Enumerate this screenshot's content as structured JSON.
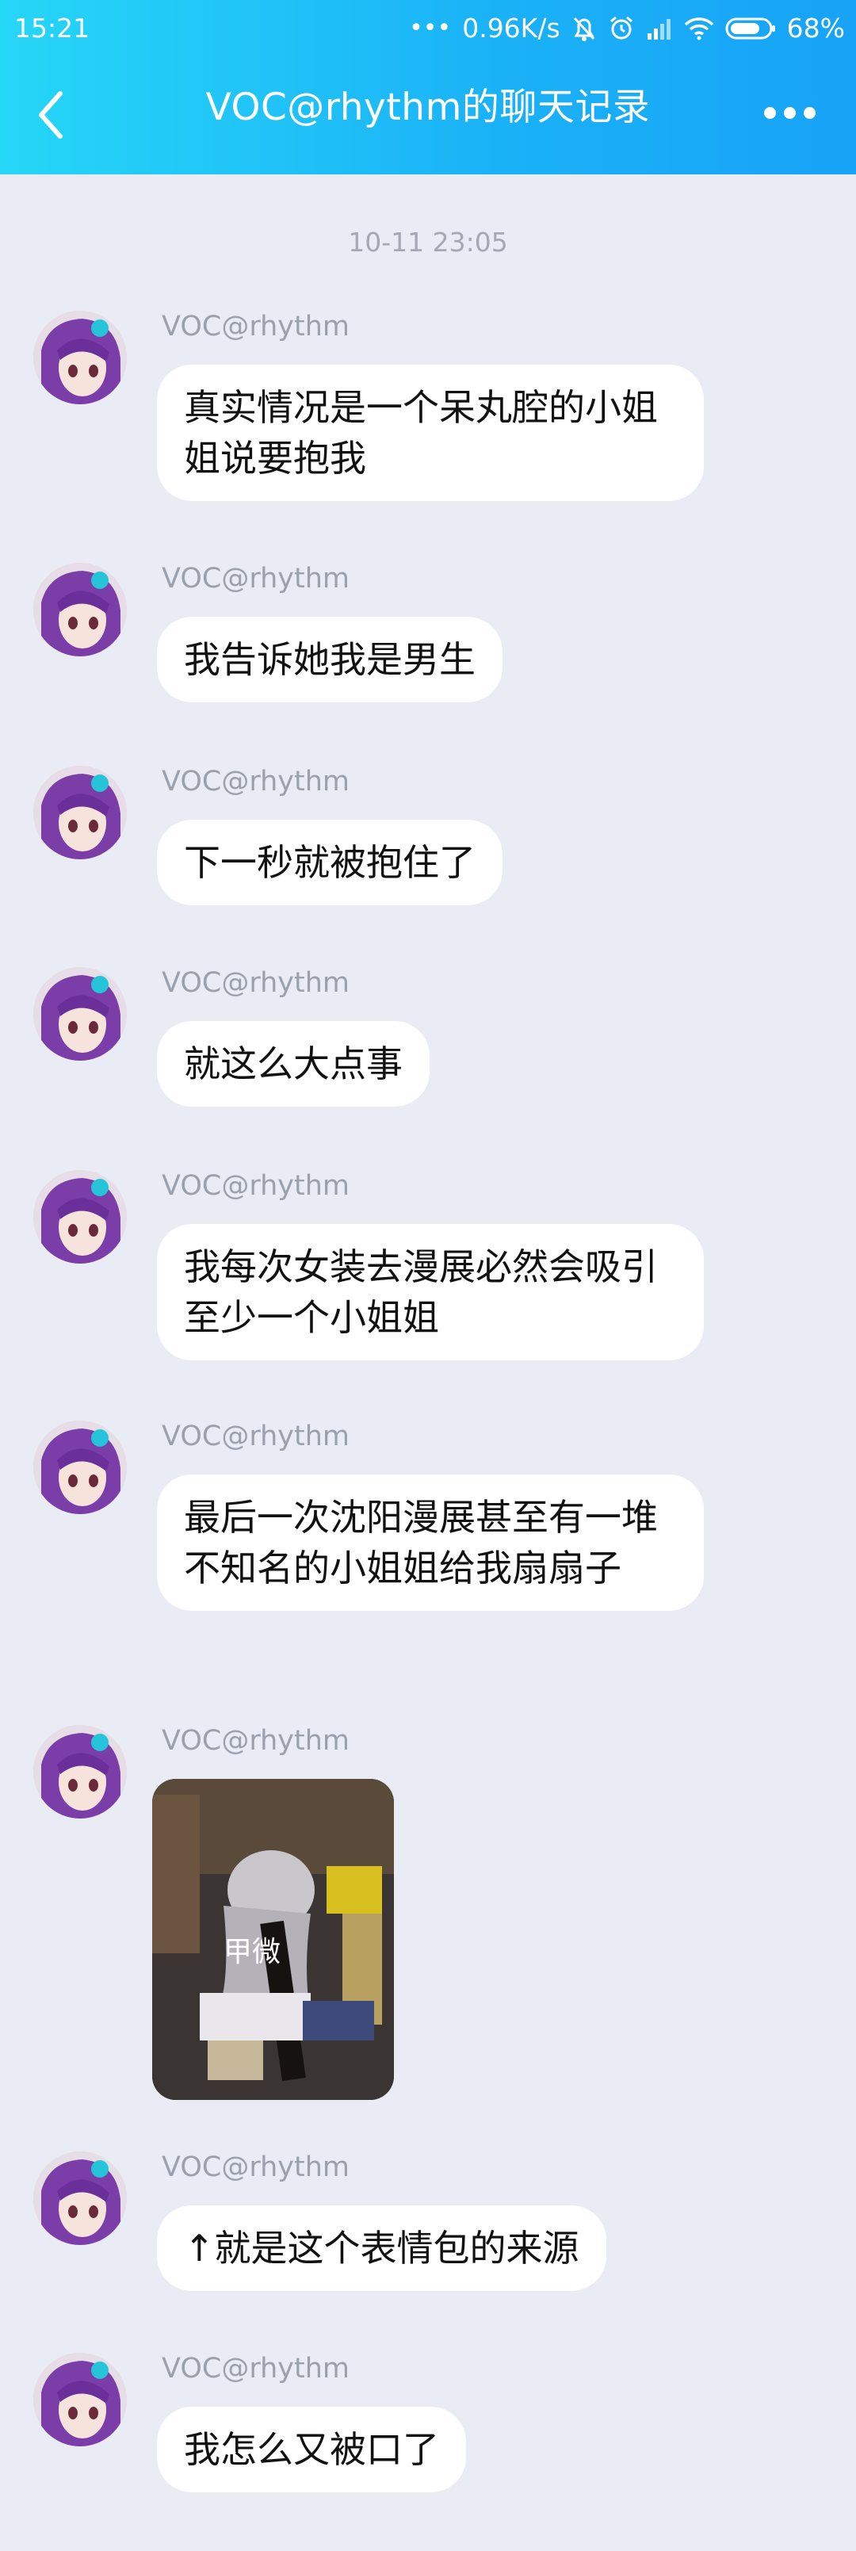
{
  "status": {
    "time": "15:21",
    "speed": "0.96K/s",
    "battery": "68%"
  },
  "header": {
    "title": "VOC@rhythm的聊天记录"
  },
  "timestamp": "10-11 23:05",
  "messages": [
    {
      "sender": "VOC@rhythm",
      "text": "真实情况是一个呆丸腔的小姐姐说要抱我"
    },
    {
      "sender": "VOC@rhythm",
      "text": "我告诉她我是男生"
    },
    {
      "sender": "VOC@rhythm",
      "text": "下一秒就被抱住了"
    },
    {
      "sender": "VOC@rhythm",
      "text": "就这么大点事"
    },
    {
      "sender": "VOC@rhythm",
      "text": "我每次女装去漫展必然会吸引至少一个小姐姐"
    },
    {
      "sender": "VOC@rhythm",
      "text": "最后一次沈阳漫展甚至有一堆不知名的小姐姐给我扇扇子"
    },
    {
      "sender": "VOC@rhythm",
      "image_caption": "甲微"
    },
    {
      "sender": "VOC@rhythm",
      "text": "↑就是这个表情包的来源"
    },
    {
      "sender": "VOC@rhythm",
      "text": "我怎么又被口了"
    }
  ]
}
